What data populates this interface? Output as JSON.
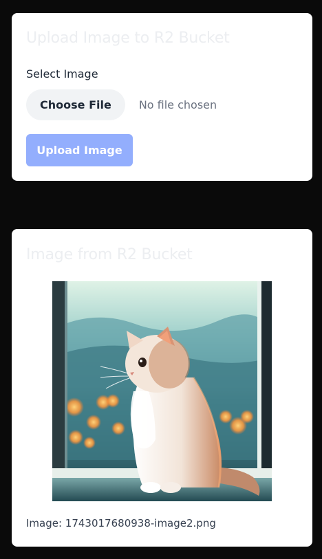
{
  "upload_card": {
    "title": "Upload Image to R2 Bucket",
    "field_label": "Select Image",
    "choose_file_label": "Choose File",
    "file_status": "No file chosen",
    "upload_button_label": "Upload Image"
  },
  "image_card": {
    "title": "Image from R2 Bucket",
    "caption": "Image: 1743017680938-image2.png"
  },
  "colors": {
    "page_background": "#0a0a0a",
    "card_background": "#ffffff",
    "upload_button": "#93aefd",
    "choose_file_button": "#f1f3f5"
  }
}
